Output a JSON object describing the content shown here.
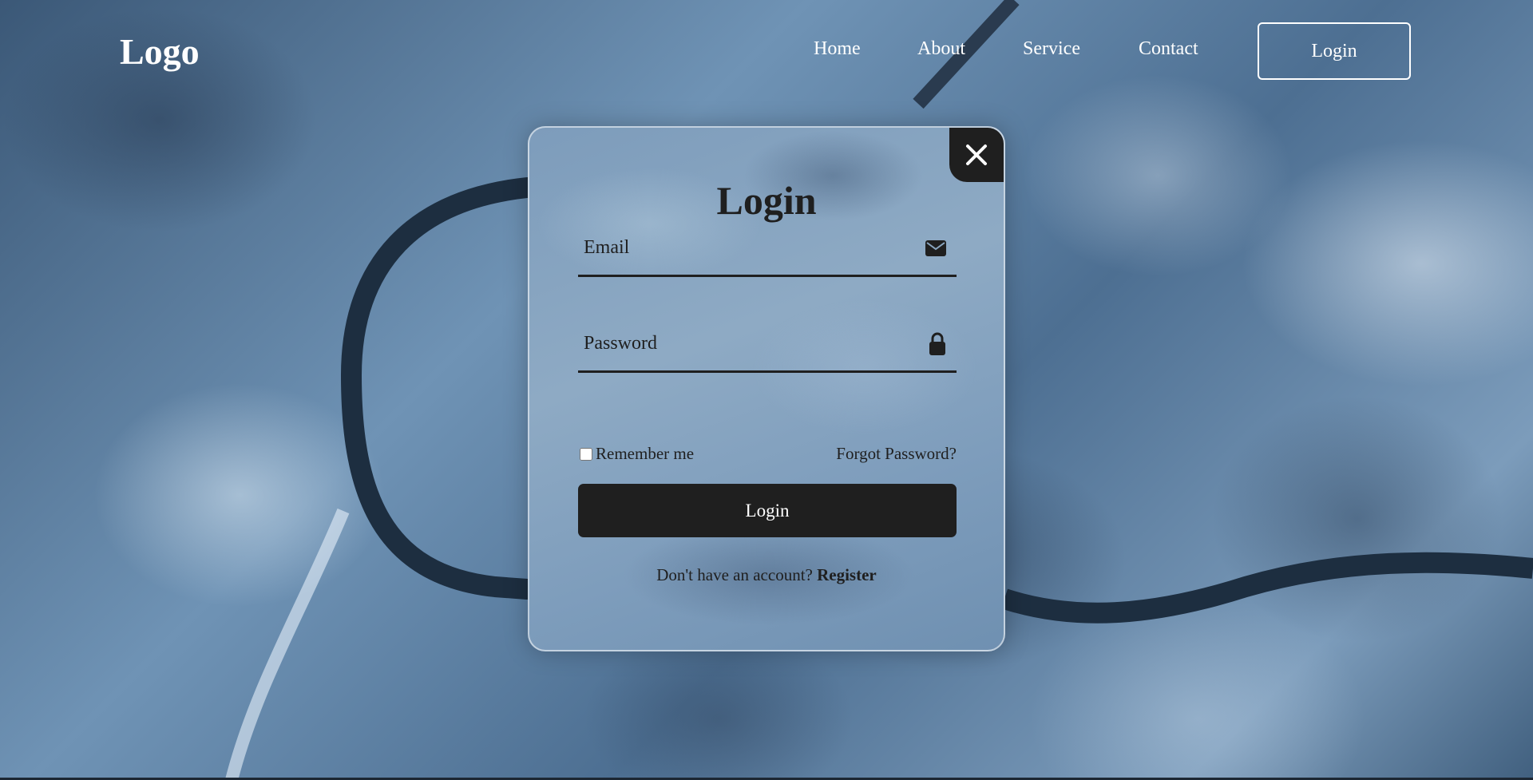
{
  "header": {
    "logo": "Logo",
    "nav": [
      "Home",
      "About",
      "Service",
      "Contact"
    ],
    "login_button": "Login"
  },
  "modal": {
    "title": "Login",
    "close_icon": "close-icon",
    "email": {
      "label": "Email",
      "value": "",
      "icon": "envelope-icon"
    },
    "password": {
      "label": "Password",
      "value": "",
      "icon": "lock-icon"
    },
    "remember_label": "Remember me",
    "remember_checked": false,
    "forgot_link": "Forgot Password?",
    "submit_label": "Login",
    "register_prompt": "Don't have an account?",
    "register_link": "Register"
  },
  "colors": {
    "dark": "#1f1f1f",
    "white": "#ffffff",
    "background_blue": "#5d7f9f"
  }
}
